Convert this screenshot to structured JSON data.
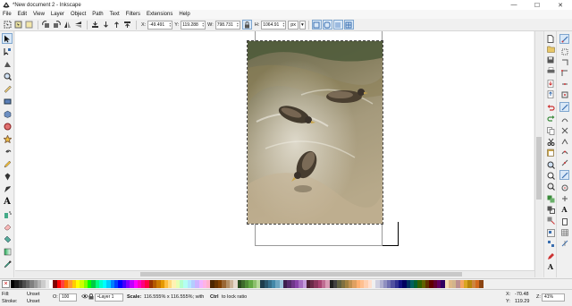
{
  "window": {
    "title": "*New document 2 - Inkscape",
    "minimize": "—",
    "maximize": "☐",
    "close": "✕"
  },
  "menu": [
    "File",
    "Edit",
    "View",
    "Layer",
    "Object",
    "Path",
    "Text",
    "Filters",
    "Extensions",
    "Help"
  ],
  "controls": {
    "x_label": "X:",
    "x_value": "-49.491",
    "y_label": "Y:",
    "y_value": "119.288",
    "w_label": "W:",
    "w_value": "798.731",
    "h_label": "H:",
    "h_value": "1064.91",
    "unit": "px",
    "unit_arrow": "▾"
  },
  "statusbar": {
    "fill_label": "Fill:",
    "fill_value": "Unset",
    "stroke_label": "Stroke:",
    "stroke_value": "Unset",
    "opacity_label": "O:",
    "opacity_value": "100",
    "layer_value": "•Layer 1",
    "message_bold": "Scale:",
    "message": "116.555% x 116.555%; with",
    "message_key": "Ctrl",
    "message_tail": "to lock ratio",
    "coord_x_label": "X:",
    "coord_x": "-70.48",
    "coord_y_label": "Y:",
    "coord_y": "119.29",
    "zoom_label": "Z:",
    "zoom_value": "41%"
  },
  "icons": {
    "app": "inkscape-logo-icon",
    "selected_tool": "selector-arrow-icon"
  },
  "colors": {
    "accent": "#4a7fc1",
    "selection_dash": "#444444",
    "toggle_bg": "#d9e8f7"
  },
  "palette": [
    "#000000",
    "#1a1a1a",
    "#333333",
    "#4d4d4d",
    "#666666",
    "#808080",
    "#999999",
    "#b3b3b3",
    "#cccccc",
    "#e6e6e6",
    "#ffffff",
    "#800000",
    "#ff0000",
    "#ff4040",
    "#ff6a00",
    "#ff9933",
    "#ffcc00",
    "#ffff00",
    "#ccff00",
    "#80ff00",
    "#00ff00",
    "#00cc44",
    "#00ff80",
    "#00ffcc",
    "#00ffff",
    "#00ccff",
    "#0080ff",
    "#0040ff",
    "#0000ff",
    "#4000ff",
    "#8000ff",
    "#bf00ff",
    "#ff00ff",
    "#ff00bf",
    "#ff0080",
    "#ff0040",
    "#993300",
    "#b35900",
    "#cc7a00",
    "#e69900",
    "#ffbf40",
    "#ffd980",
    "#fff2b3",
    "#e6ffb3",
    "#b3ffcc",
    "#b3fff2",
    "#b3e6ff",
    "#b3ccff",
    "#ccb3ff",
    "#f2b3ff",
    "#ffb3e6",
    "#ffb3cc",
    "#4d2600",
    "#663300",
    "#804000",
    "#996633",
    "#b38f66",
    "#ccb399",
    "#e6d9cc",
    "#2b4c1f",
    "#3d6b2b",
    "#4f8a37",
    "#62a844",
    "#8cc06d",
    "#b6d99a",
    "#1f3d4c",
    "#2b566b",
    "#376f8a",
    "#4488a8",
    "#6da5c0",
    "#9ac3d9",
    "#3d1f4c",
    "#562b6b",
    "#6f378a",
    "#8844a8",
    "#a56dc0",
    "#c39ad9",
    "#4c1f33",
    "#6b2b48",
    "#8a375c",
    "#a84471",
    "#c06d92",
    "#d99ab4",
    "#202020",
    "#404040",
    "#606040",
    "#807040",
    "#a08040",
    "#c09050",
    "#e0a060",
    "#ffb070",
    "#ffc090",
    "#ffd0b0",
    "#ffe0d0",
    "#f0f0f0",
    "#d0d0e0",
    "#b0b0d0",
    "#9090c0",
    "#7070b0",
    "#5050a0",
    "#303090",
    "#101080",
    "#000060",
    "#003060",
    "#006060",
    "#006030",
    "#306000",
    "#606000",
    "#603000",
    "#600000",
    "#600030",
    "#600060",
    "#300060",
    "#f5deb3",
    "#deb887",
    "#d2b48c",
    "#bc8f8f",
    "#f4a460",
    "#daa520",
    "#b8860b",
    "#cd853f",
    "#d2691e",
    "#8b4513"
  ]
}
